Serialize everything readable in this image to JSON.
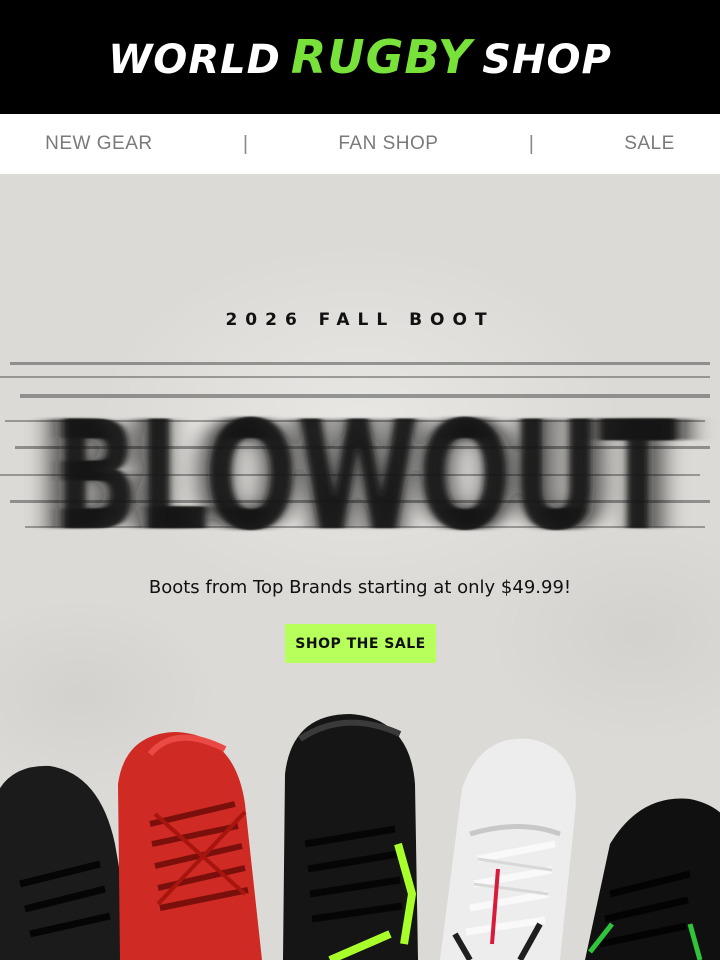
{
  "header": {
    "logo_world": "WORLD",
    "logo_rugby": "RUGBY",
    "logo_shop": "SHOP",
    "colors": {
      "background": "#000000",
      "accent": "#78e23b"
    }
  },
  "nav": {
    "items": [
      {
        "label": "NEW GEAR"
      },
      {
        "label": "FAN SHOP"
      },
      {
        "label": "SALE"
      }
    ],
    "separator": "|"
  },
  "hero": {
    "kicker": "2026 FALL BOOT",
    "headline": "BLOWOUT",
    "tagline": "Boots from Top Brands starting at only $49.99!",
    "cta_label": "SHOP THE SALE",
    "cta_color": "#b7ff5a",
    "boot_colors": [
      "#1a1a1a",
      "#d22a25",
      "#141414",
      "#eeeeee",
      "#0e0e0e"
    ]
  }
}
